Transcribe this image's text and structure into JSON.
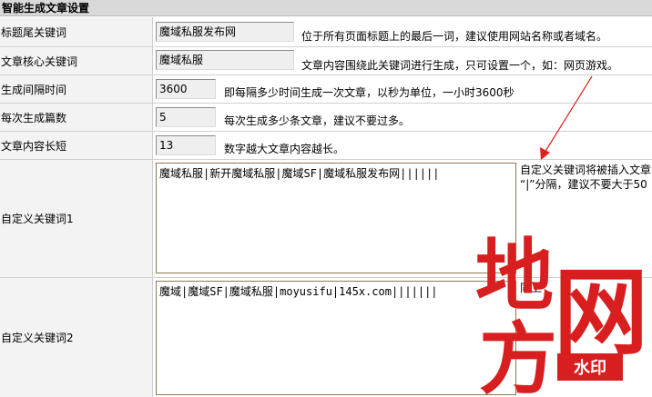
{
  "header": {
    "title": "智能生成文章设置"
  },
  "rows": [
    {
      "label": "标题尾关键词",
      "value": "魔域私服发布网",
      "hint": "位于所有页面标题上的最后一词，建议使用网站名称或者域名。"
    },
    {
      "label": "文章核心关键词",
      "value": "魔域私服",
      "hint": "文章内容围绕此关键词进行生成，只可设置一个，如：网页游戏。"
    },
    {
      "label": "生成间隔时间",
      "value": "3600",
      "hint": "即每隔多少时间生成一次文章，以秒为单位，一小时3600秒"
    },
    {
      "label": "每次生成篇数",
      "value": "5",
      "hint": "每次生成多少条文章，建议不要过多。"
    },
    {
      "label": "文章内容长短",
      "value": "13",
      "hint": "数字越大文章内容越长。"
    }
  ],
  "custom1": {
    "label": "自定义关键词1",
    "value": "魔域私服|新开魔域私服|魔域SF|魔域私服发布网||||||",
    "note_line1": "自定义关键词将被插入文章",
    "note_line2": "“|”分隔，建议不要大于50"
  },
  "custom2": {
    "label": "自定义关键词2",
    "value": "魔域|魔域SF|魔域私服|moyusifu|145x.com|||||||",
    "note": "同上"
  },
  "watermark": {
    "char1": "地",
    "char2": "方",
    "char3": "网",
    "badge": "水印"
  },
  "colors": {
    "header_bg": "#d9d9d9",
    "label_bg": "#f3f3f3",
    "arrow": "#e02020",
    "watermark_red": "#d81e1e"
  }
}
